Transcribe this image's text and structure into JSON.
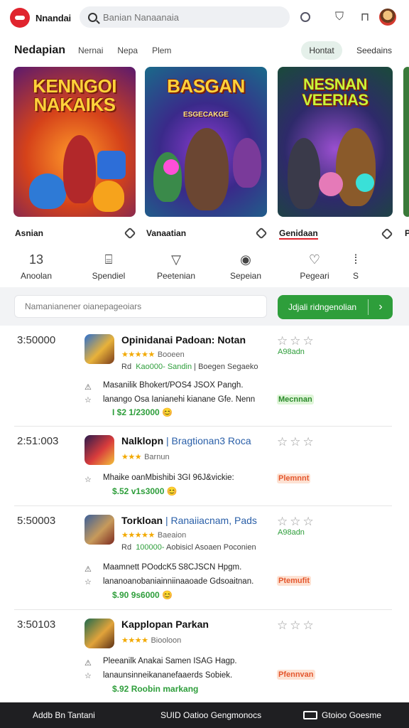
{
  "header": {
    "brand": "Nnandai",
    "search_placeholder": "Banian Nanaanaia"
  },
  "nav": {
    "section_title": "Nedapian",
    "tabs": [
      "Nernai",
      "Nepa",
      "Plem"
    ],
    "active_pill": "Hontat",
    "see_all": "Seedains"
  },
  "carousel": [
    {
      "title": "KENNGOI NAKAIKS",
      "subtitle": "",
      "label": "Asnian",
      "category": "Anoolan",
      "category_icon": "glyph-13-icon"
    },
    {
      "title": "BASGAN",
      "subtitle": "ESGECAKGE",
      "label": "Vanaatian",
      "category": "Spendiel",
      "category_icon": "chat-icon"
    },
    {
      "title": "NESNAN VEERIAS",
      "subtitle": "",
      "label": "Genidaan",
      "category": "Peetenian",
      "category_icon": "speech-icon"
    },
    {
      "title": "",
      "subtitle": "",
      "label": "P",
      "category": "S",
      "category_icon": "glyph-icon"
    }
  ],
  "categories_extra": [
    {
      "label": "Sepeian",
      "icon": "clock-icon"
    },
    {
      "label": "Pegeari",
      "icon": "heart-icon"
    }
  ],
  "filter": {
    "placeholder": "Namanianener oianepageoiars",
    "button_label": "Jdjali ridngenolian"
  },
  "list": [
    {
      "rank": "3:50000",
      "name": "Opinidanai Padoan: Notan",
      "stars": "★★★★★",
      "rating_text": "Booeen",
      "meta_prefix": "Rd",
      "meta_highlight": "Kao000- Sandin",
      "meta_suffix": "| Boegen Segaeko",
      "desc1": "Masanilik Bhokert/POS4 JSOX Pangh.",
      "desc2": "lanango Osa Ianianehi kianane Gfe. Nenn",
      "price": "I $2 1/23000",
      "price_em": "😊",
      "right_note": "A98adn",
      "badge": "Mecnnan",
      "badge_color": "green",
      "thumb_colors": [
        "#2b6fcf",
        "#e8b23a",
        "#7a3c1c"
      ]
    },
    {
      "rank": "2:51:003",
      "name": "Nalklopn",
      "name_suffix": "| Bragtionan3 Roca",
      "stars": "★★★",
      "rating_text": "Barnun",
      "desc1": "Mhaike oanMbishibi 3GI 96J&vickie:",
      "price": "$.52 v1s3000",
      "price_em": "😊",
      "badge": "Plemnnt",
      "badge_color": "orange",
      "thumb_colors": [
        "#2a1b4d",
        "#d93c3c",
        "#f2c23a"
      ]
    },
    {
      "rank": "5:50003",
      "name": "Torkloan",
      "name_suffix": "| Ranaiiacnam, Pads",
      "stars": "★★★★★",
      "rating_text": "Baeaion",
      "meta_prefix": "Rd",
      "meta_highlight": "100000-",
      "meta_suffix": "Aobisicl Asoaen Poconien",
      "desc1": "Maamnett POodcK5 S8CJSCN Hpgm.",
      "desc2": "lananoanobaniainniinaaoade Gdsoaitnan.",
      "price": "$.90 9s6000",
      "price_em": "😊",
      "right_note": "A98adn",
      "badge": "Ptemufit",
      "badge_color": "orange",
      "thumb_colors": [
        "#3a5f9a",
        "#c79a5b",
        "#7c2a20"
      ]
    },
    {
      "rank": "3:50103",
      "name": "Kapplopan Parkan",
      "stars": "★★★★",
      "rating_text": "Biooloon",
      "desc1": "Pleeanilk Anakai Samen ISAG Hagp.",
      "desc2": "lanaunsinneikananefaaerds Sobiek.",
      "price": "$.92 Roobin markang",
      "badge": "Pfennvan",
      "badge_color": "orange",
      "thumb_colors": [
        "#1e6a4e",
        "#e1a33b",
        "#5a2f16"
      ]
    }
  ],
  "bottombar": {
    "item1": "Addb Bn Tantani",
    "item2": "SUID Oatioo Gengmonocs",
    "item3": "Gtoioo Goesme"
  },
  "colors": {
    "accent_green": "#2e9e3b",
    "brand_red": "#e0242e",
    "star": "#f2a900"
  }
}
